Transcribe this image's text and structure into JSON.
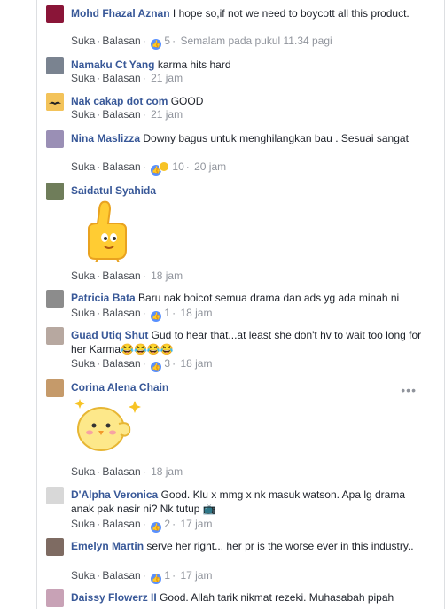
{
  "labels": {
    "like": "Suka",
    "reply": "Balasan"
  },
  "comments": [
    {
      "author": "Mohd Fhazal Aznan",
      "text": "I hope so,if not we need to boycott all this product.",
      "reactions": "5",
      "time": "Semalam pada pukul 11.34 pagi"
    },
    {
      "author": "Namaku Ct Yang",
      "text": "karma hits hard",
      "time": "21 jam"
    },
    {
      "author": "Nak cakap dot com",
      "text": "GOOD",
      "time": "21 jam"
    },
    {
      "author": "Nina Maslizza",
      "text": "Downy bagus untuk menghilangkan bau . Sesuai sangat",
      "reactions": "10",
      "time": "20 jam"
    },
    {
      "author": "Saidatul Syahida",
      "text": "",
      "time": "18 jam"
    },
    {
      "author": "Patricia Bata",
      "text": "Baru nak boicot semua drama dan ads yg ada minah ni",
      "reactions": "1",
      "time": "18 jam"
    },
    {
      "author": "Guad Utiq Shut",
      "text": "Gud to hear that...at least she don't hv to wait too long for her Karma😂😂😂😂",
      "reactions": "3",
      "time": "18 jam"
    },
    {
      "author": "Corina Alena Chain",
      "text": "",
      "time": "18 jam"
    },
    {
      "author": "D'Alpha Veronica",
      "text": "Good. Klu x mmg x nk masuk watson. Apa lg drama anak pak nasir ni? Nk tutup 📺",
      "reactions": "2",
      "time": "17 jam"
    },
    {
      "author": "Emelyn Martin",
      "text": "serve her right... her pr is the worse ever in this industry..",
      "reactions": "1",
      "time": "17 jam"
    },
    {
      "author": "Daissy Flowerz II",
      "text": "Good. Allah tarik nikmat rezeki. Muhasabah pipah",
      "time": ""
    }
  ],
  "more_menu": "•••",
  "colors": {
    "link": "#385898",
    "meta": "#90949c",
    "like": "#5890ff"
  }
}
